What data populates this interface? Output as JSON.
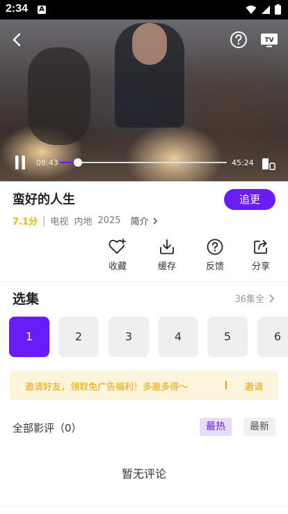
{
  "status": {
    "time": "2:34"
  },
  "player": {
    "current_time": "08:43",
    "total_time": "45:24",
    "progress": 0.11
  },
  "show": {
    "title": "蛮好的人生",
    "follow_label": "追更",
    "score": "7.1分",
    "divider": "|",
    "type": "电视",
    "region": "内地",
    "year": "2025",
    "intro_label": "简介"
  },
  "actions": [
    {
      "label": "收藏",
      "icon": "heart-plus-icon"
    },
    {
      "label": "缓存",
      "icon": "download-icon"
    },
    {
      "label": "反馈",
      "icon": "help-circle-icon"
    },
    {
      "label": "分享",
      "icon": "share-icon"
    }
  ],
  "episodes": {
    "title": "选集",
    "all_label": "36集全",
    "items": [
      "1",
      "2",
      "3",
      "4",
      "5",
      "6"
    ],
    "selected": "1"
  },
  "banner": {
    "text": "邀请好友，领取免广告福利！多邀多得～",
    "action": "邀请"
  },
  "reviews": {
    "title": "全部影评（0）",
    "hot": "最热",
    "new": "最新",
    "empty": "暂无评论"
  },
  "colors": {
    "accent": "#6a1cf6",
    "score": "#f4b400",
    "banner_text": "#f2a200",
    "banner_bg": "#fdf4dc"
  }
}
